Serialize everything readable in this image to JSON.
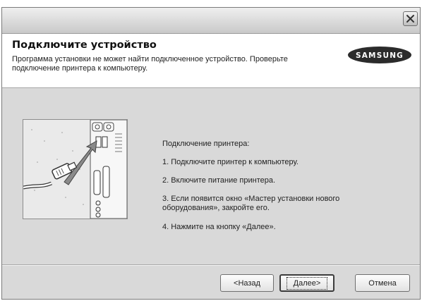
{
  "window": {
    "close_icon": "close-icon"
  },
  "header": {
    "title": "Подключите устройство",
    "subtitle": "Программа установки не может найти подключенное устройство. Проверьте подключение принтера к компьютеру.",
    "logo_text": "SAMSUNG"
  },
  "instructions": {
    "heading": "Подключение принтера:",
    "steps": [
      "1. Подключите принтер к компьютеру.",
      "2. Включите питание принтера.",
      "3. Если появится окно «Мастер установки нового оборудования», закройте его.",
      "4. Нажмите на кнопку «Далее»."
    ]
  },
  "buttons": {
    "back": "<Назад",
    "next": "Далее>",
    "cancel": "Отмена"
  },
  "colors": {
    "dialog_bg": "#d9d9d9",
    "header_bg": "#ffffff",
    "logo_bg": "#2b2b2b"
  },
  "icons": [
    "close-icon",
    "samsung-logo",
    "usb-cable-illustration"
  ]
}
